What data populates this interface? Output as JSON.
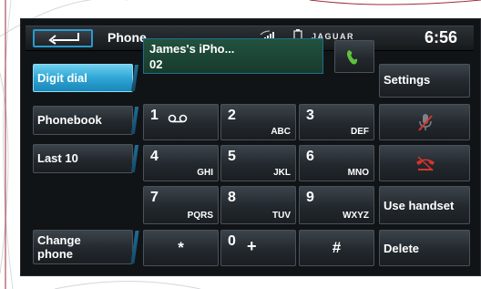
{
  "header": {
    "title": "Phone",
    "brand": "JAGUAR",
    "time": "6:56",
    "back_icon": "back-arrow-icon",
    "signal_icon": "signal-strength-icon",
    "battery_icon": "battery-icon"
  },
  "left_menu": {
    "items": [
      {
        "label": "Digit dial",
        "active": true
      },
      {
        "label": "Phonebook",
        "active": false
      },
      {
        "label": "Last 10",
        "active": false
      }
    ],
    "change_phone": "Change\nphone"
  },
  "display": {
    "device_name": "James's iPho...",
    "number": "02",
    "call_icon": "call-handset-icon"
  },
  "keypad": {
    "keys": [
      {
        "num": "1",
        "letters": "",
        "symbol": "voicemail"
      },
      {
        "num": "2",
        "letters": "ABC"
      },
      {
        "num": "3",
        "letters": "DEF"
      },
      {
        "num": "4",
        "letters": "GHI"
      },
      {
        "num": "5",
        "letters": "JKL"
      },
      {
        "num": "6",
        "letters": "MNO"
      },
      {
        "num": "7",
        "letters": "PQRS"
      },
      {
        "num": "8",
        "letters": "TUV"
      },
      {
        "num": "9",
        "letters": "WXYZ"
      },
      {
        "num": "*",
        "letters": ""
      },
      {
        "num": "0",
        "letters": "+"
      },
      {
        "num": "#",
        "letters": ""
      }
    ]
  },
  "right_menu": {
    "settings": "Settings",
    "mute_icon": "microphone-muted-icon",
    "end_call_icon": "end-call-icon",
    "use_handset": "Use handset",
    "delete": "Delete"
  },
  "colors": {
    "accent": "#2fa6d6",
    "display_green": "#1f4a38",
    "call_green": "#5ec23a",
    "end_call_red": "#d8342c"
  }
}
